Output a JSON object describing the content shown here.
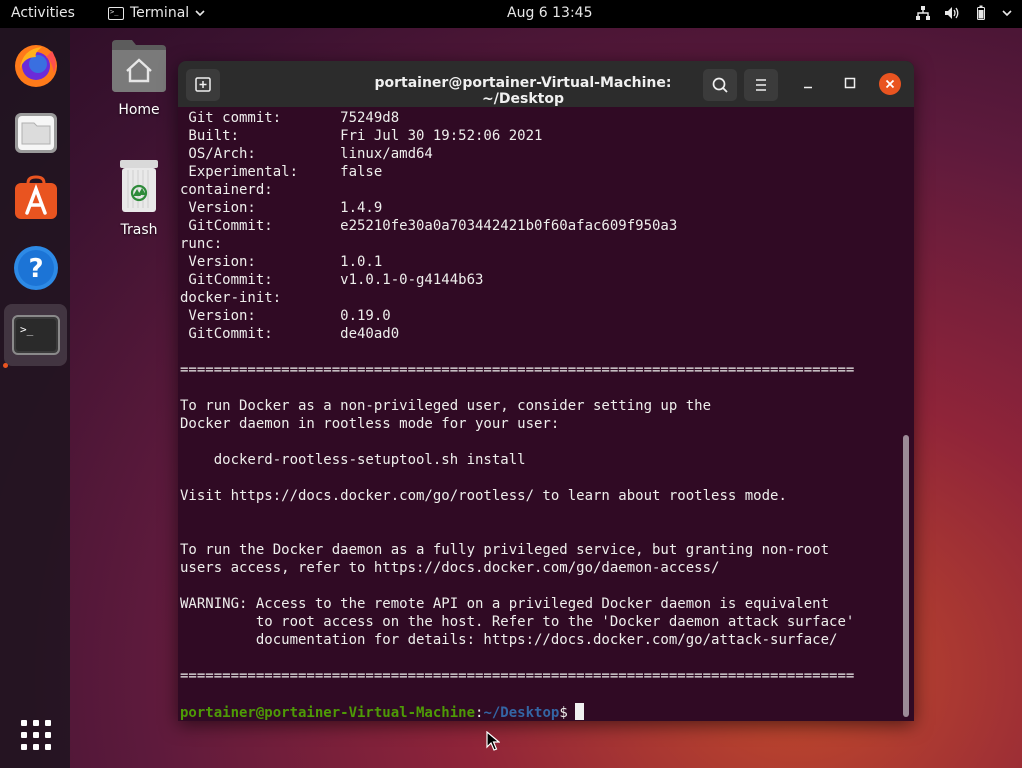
{
  "topbar": {
    "activities": "Activities",
    "app_menu": "Terminal",
    "clock": "Aug 6  13:45",
    "tray_icons": [
      "network-icon",
      "volume-icon",
      "battery-icon",
      "chevron-down-icon"
    ]
  },
  "dock": {
    "items": [
      "firefox-icon",
      "files-icon",
      "software-icon",
      "help-icon",
      "terminal-icon"
    ],
    "app_grid": "show-applications-icon"
  },
  "desktop": {
    "icons": [
      {
        "label": "Home",
        "icon": "home-folder-icon"
      },
      {
        "label": "Trash",
        "icon": "trash-icon"
      }
    ]
  },
  "terminal": {
    "title": "portainer@portainer-Virtual-Machine: ~/Desktop",
    "lines": [
      " Git commit:       75249d8",
      " Built:            Fri Jul 30 19:52:06 2021",
      " OS/Arch:          linux/amd64",
      " Experimental:     false",
      "containerd:",
      " Version:          1.4.9",
      " GitCommit:        e25210fe30a0a703442421b0f60afac609f950a3",
      "runc:",
      " Version:          1.0.1",
      " GitCommit:        v1.0.1-0-g4144b63",
      "docker-init:",
      " Version:          0.19.0",
      " GitCommit:        de40ad0",
      "",
      "================================================================================",
      "",
      "To run Docker as a non-privileged user, consider setting up the",
      "Docker daemon in rootless mode for your user:",
      "",
      "    dockerd-rootless-setuptool.sh install",
      "",
      "Visit https://docs.docker.com/go/rootless/ to learn about rootless mode.",
      "",
      "",
      "To run the Docker daemon as a fully privileged service, but granting non-root",
      "users access, refer to https://docs.docker.com/go/daemon-access/",
      "",
      "WARNING: Access to the remote API on a privileged Docker daemon is equivalent",
      "         to root access on the host. Refer to the 'Docker daemon attack surface'",
      "         documentation for details: https://docs.docker.com/go/attack-surface/",
      "",
      "================================================================================",
      ""
    ],
    "prompt": {
      "user_host": "portainer@portainer-Virtual-Machine",
      "separator": ":",
      "path": "~/Desktop",
      "symbol": "$"
    }
  }
}
